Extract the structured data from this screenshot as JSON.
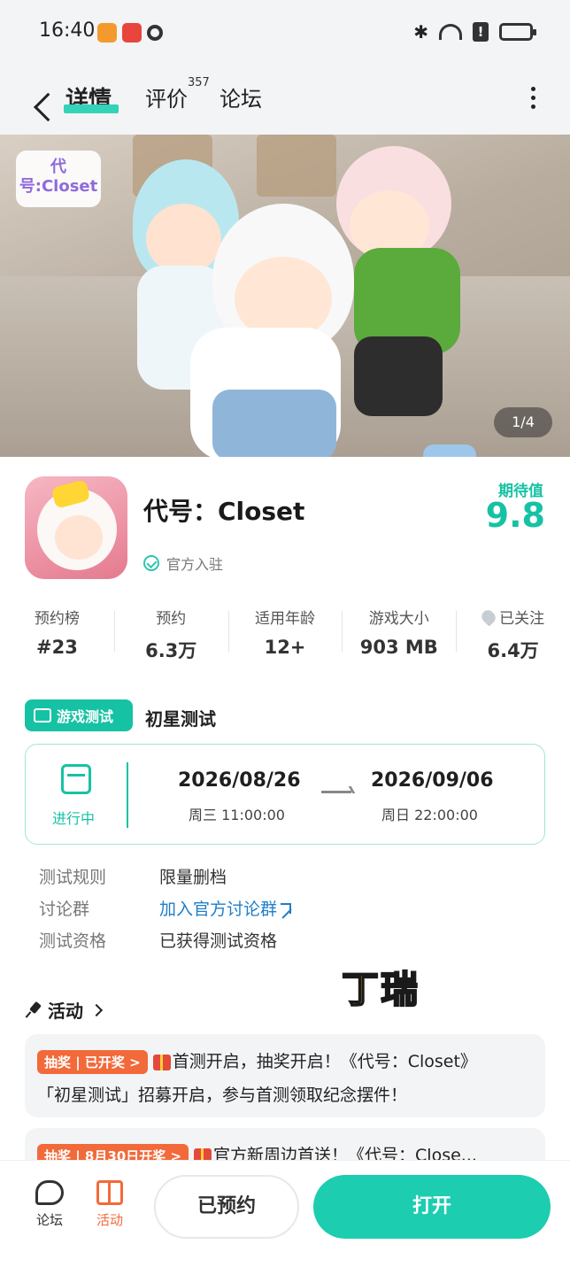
{
  "status_bar": {
    "time": "16:40"
  },
  "nav": {
    "tab_detail": "详情",
    "tab_review": "评价",
    "review_count": "357",
    "tab_forum": "论坛"
  },
  "banner": {
    "logo_text": "代号:Closet",
    "page_indicator": "1/4"
  },
  "app": {
    "title": "代号：Closet",
    "official_label": "官方入驻",
    "expect_label": "期待值",
    "expect_value": "9.8"
  },
  "stats": [
    {
      "label": "预约榜",
      "value": "#23"
    },
    {
      "label": "预约",
      "value": "6.3万"
    },
    {
      "label": "适用年龄",
      "value": "12+"
    },
    {
      "label": "游戏大小",
      "value": "903 MB"
    },
    {
      "label": "已关注",
      "value": "6.4万"
    }
  ],
  "test": {
    "badge": "游戏测试",
    "title": "初星测试",
    "status": "进行中",
    "start_date": "2026/08/26",
    "start_time": "周三  11:00:00",
    "end_date": "2026/09/06",
    "end_time": "周日  22:00:00",
    "rule_label": "测试规则",
    "rule_value": "限量删档",
    "group_label": "讨论群",
    "group_value": "加入官方讨论群",
    "qualify_label": "测试资格",
    "qualify_value": "已获得测试资格"
  },
  "watermark": "丁瑞",
  "activities": {
    "header": "活动",
    "items": [
      {
        "badge": "抽奖 | 已开奖 >",
        "line1": "首测开启，抽奖开启！《代号：Closet》",
        "line2": "「初星测试」招募开启，参与首测领取纪念摆件！"
      },
      {
        "badge": "抽奖 | 8月30日开奖 >",
        "line1": "官方新周边首送！《代号：Close..."
      }
    ]
  },
  "bottom": {
    "forum": "论坛",
    "activity": "活动",
    "reserved": "已预约",
    "open": "打开"
  }
}
